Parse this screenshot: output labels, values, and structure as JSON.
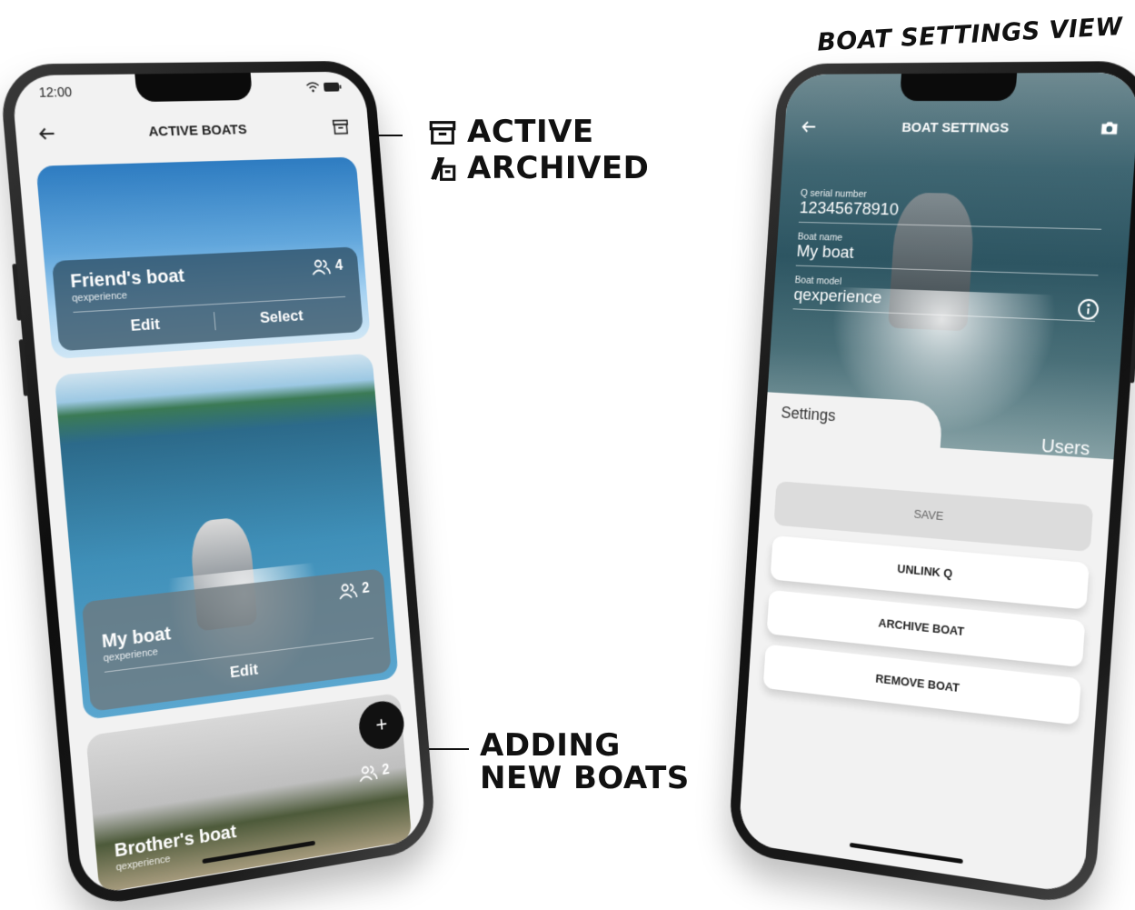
{
  "annotations": {
    "view_title": "BOAT SETTINGS VIEW",
    "active": "ACTIVE",
    "archived": "ARCHIVED",
    "adding_line1": "ADDING",
    "adding_line2": "NEW BOATS"
  },
  "left_phone": {
    "status_time": "12:00",
    "header_title": "ACTIVE BOATS",
    "boats": [
      {
        "name": "Friend's boat",
        "model": "qexperience",
        "users": "4",
        "actions": [
          "Edit",
          "Select"
        ]
      },
      {
        "name": "My boat",
        "model": "qexperience",
        "users": "2",
        "actions": [
          "Edit"
        ]
      },
      {
        "name": "Brother's boat",
        "model": "qexperience",
        "users": "2"
      }
    ],
    "fab_label": "+"
  },
  "right_phone": {
    "header_title": "BOAT SETTINGS",
    "fields": [
      {
        "label": "Q serial number",
        "value": "12345678910"
      },
      {
        "label": "Boat name",
        "value": "My boat"
      },
      {
        "label": "Boat model",
        "value": "qexperience"
      }
    ],
    "tabs": [
      "Settings",
      "Users"
    ],
    "buttons": [
      "SAVE",
      "UNLINK Q",
      "ARCHIVE BOAT",
      "REMOVE BOAT"
    ]
  }
}
